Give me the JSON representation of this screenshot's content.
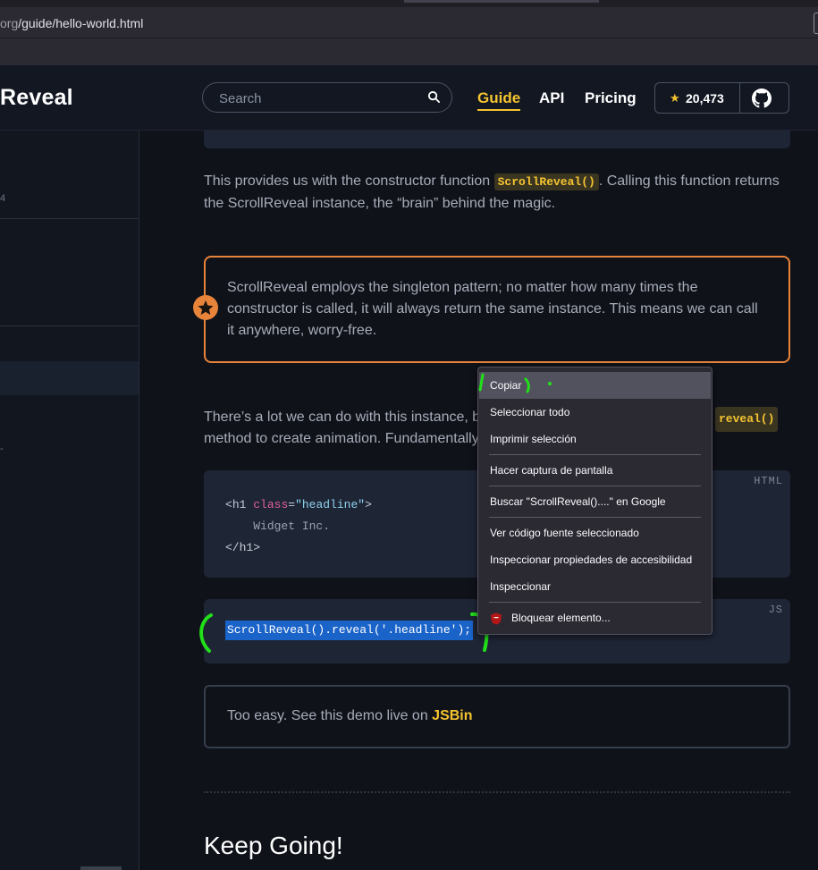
{
  "browser": {
    "url_visible": "org/guide/hello-world.html",
    "url_domain_part": "org",
    "url_path_part": "/guide/hello-world.html"
  },
  "header": {
    "brand": "Reveal",
    "search_placeholder": "Search",
    "nav": [
      "Guide",
      "API",
      "Pricing"
    ],
    "active_nav": "Guide",
    "github_stars": "20,473",
    "icons": [
      "search-icon",
      "star-icon",
      "github-icon"
    ]
  },
  "sidebar": {
    "fragment_text": "4",
    "fragment_tick": "-"
  },
  "content": {
    "code_tail_visible": true,
    "para1_before": "This provides us with the constructor function ",
    "para1_code": "ScrollReveal()",
    "para1_after": ". Calling this function returns the ScrollReveal instance, the “brain” behind the magic.",
    "callout_text": "ScrollReveal employs the singleton pattern; no matter how many times the constructor is called, it will always return the same instance. This means we can call it anywhere, worry-free.",
    "para2_line1": "There’s a lot we can do with this instance, b",
    "para2_code": "reveal()",
    "para2_line2": "method to create animation. Fundamentally",
    "code_html_lang": "HTML",
    "code_html_line1_open": "<",
    "code_html_line1_tag": "h1",
    "code_html_line1_attr": "class",
    "code_html_line1_eq": "=",
    "code_html_line1_val": "\"headline\"",
    "code_html_line1_close": ">",
    "code_html_line2": "Widget Inc.",
    "code_html_line3": "</h1>",
    "code_js_lang": "JS",
    "code_js_line": "ScrollReveal().reveal('.headline');",
    "tip_text": "Too easy. See this demo live on ",
    "tip_link": "JSBin",
    "heading": "Keep Going!"
  },
  "context_menu": {
    "items": [
      "Copiar",
      "Seleccionar todo",
      "Imprimir selección",
      "Hacer captura de pantalla",
      "Buscar \"ScrollReveal()....\" en Google",
      "Ver código fuente seleccionado",
      "Inspeccionar propiedades de accesibilidad",
      "Inspeccionar",
      "Bloquear elemento..."
    ],
    "hovered": "Copiar"
  },
  "colors": {
    "accent": "#f5c431",
    "callout_border": "#e8833a",
    "selection": "#1a63c9",
    "annotation": "#22e01a"
  }
}
